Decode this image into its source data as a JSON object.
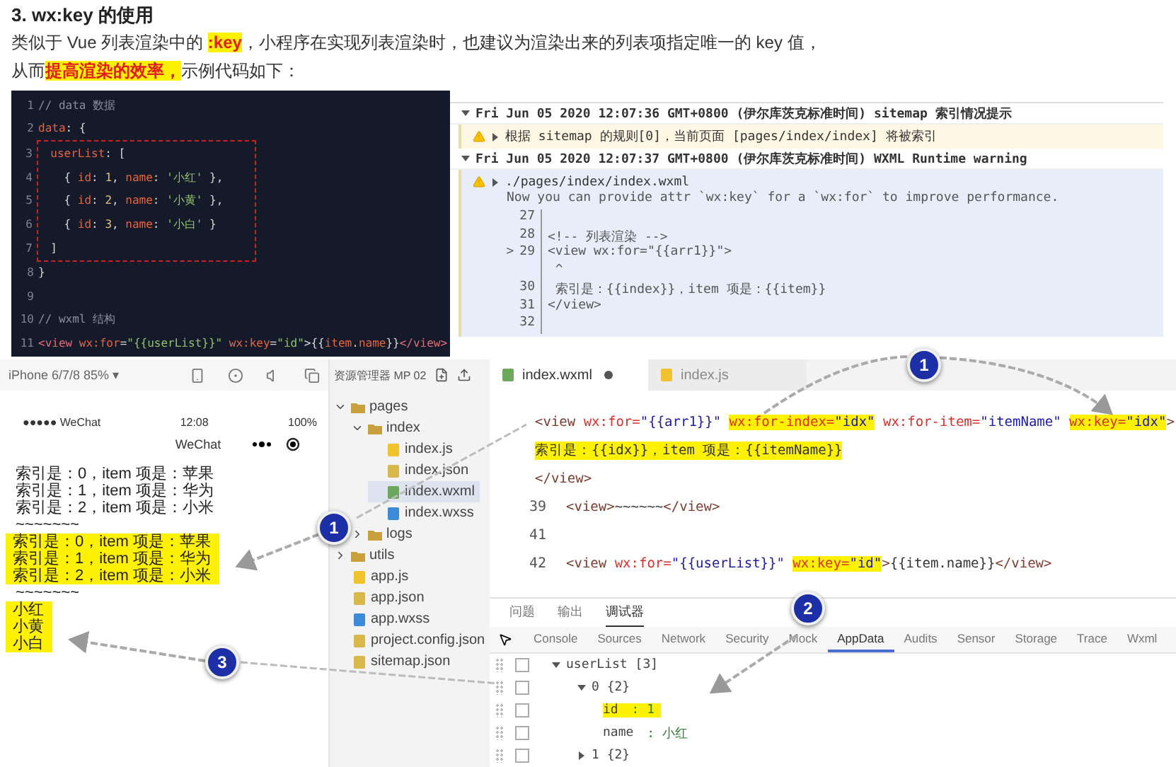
{
  "article": {
    "heading": "3. wx:key 的使用",
    "paragraph": [
      {
        "text": "类似于 Vue 列表渲染中的 ",
        "highlight": false
      },
      {
        "text": ":key",
        "highlight": true
      },
      {
        "text": "，小程序在实现列表渲染时，也建议为渲染出来的列表项指定唯一的 key 值，",
        "highlight": false
      }
    ],
    "paragraph2": [
      {
        "text": "从而",
        "highlight": false
      },
      {
        "text": "提高渲染的效率，",
        "highlight": true
      },
      {
        "text": "示例代码如下：",
        "highlight": false
      }
    ]
  },
  "code_sample": {
    "lines": [
      {
        "number": "1",
        "boxed": false,
        "tokens": [
          {
            "kind": "comment",
            "text": "// data 数据"
          }
        ]
      },
      {
        "number": "2",
        "boxed": false,
        "tokens": [
          {
            "kind": "key",
            "text": "data"
          },
          {
            "kind": "punct",
            "text": ": {"
          }
        ]
      },
      {
        "number": "3",
        "boxed": true,
        "tokens": [
          {
            "kind": "key",
            "text": "  userList"
          },
          {
            "kind": "punct",
            "text": ": ["
          }
        ]
      },
      {
        "number": "4",
        "boxed": true,
        "tokens": [
          {
            "kind": "punct",
            "text": "    { "
          },
          {
            "kind": "key",
            "text": "id"
          },
          {
            "kind": "punct",
            "text": ": "
          },
          {
            "kind": "number",
            "text": "1"
          },
          {
            "kind": "punct",
            "text": ", "
          },
          {
            "kind": "key",
            "text": "name"
          },
          {
            "kind": "punct",
            "text": ": "
          },
          {
            "kind": "string",
            "text": "'小红'"
          },
          {
            "kind": "punct",
            "text": " },"
          }
        ]
      },
      {
        "number": "5",
        "boxed": true,
        "tokens": [
          {
            "kind": "punct",
            "text": "    { "
          },
          {
            "kind": "key",
            "text": "id"
          },
          {
            "kind": "punct",
            "text": ": "
          },
          {
            "kind": "number",
            "text": "2"
          },
          {
            "kind": "punct",
            "text": ", "
          },
          {
            "kind": "key",
            "text": "name"
          },
          {
            "kind": "punct",
            "text": ": "
          },
          {
            "kind": "string",
            "text": "'小黄'"
          },
          {
            "kind": "punct",
            "text": " },"
          }
        ]
      },
      {
        "number": "6",
        "boxed": true,
        "tokens": [
          {
            "kind": "punct",
            "text": "    { "
          },
          {
            "kind": "key",
            "text": "id"
          },
          {
            "kind": "punct",
            "text": ": "
          },
          {
            "kind": "number",
            "text": "3"
          },
          {
            "kind": "punct",
            "text": ", "
          },
          {
            "kind": "key",
            "text": "name"
          },
          {
            "kind": "punct",
            "text": ": "
          },
          {
            "kind": "string",
            "text": "'小白'"
          },
          {
            "kind": "punct",
            "text": " }"
          }
        ]
      },
      {
        "number": "7",
        "boxed": true,
        "tokens": [
          {
            "kind": "punct",
            "text": "  ]"
          }
        ]
      },
      {
        "number": "8",
        "boxed": false,
        "tokens": [
          {
            "kind": "punct",
            "text": "}"
          }
        ]
      },
      {
        "number": "9",
        "boxed": false
      },
      {
        "number": "10",
        "boxed": false,
        "tokens": [
          {
            "kind": "comment",
            "text": "// wxml 结构"
          }
        ]
      },
      {
        "number": "11",
        "boxed": false,
        "tokens": [
          {
            "kind": "tag",
            "text": "<view"
          },
          {
            "kind": "key",
            "text": " wx:for"
          },
          {
            "kind": "punct",
            "text": "="
          },
          {
            "kind": "string",
            "text": "\"{{userList}}\""
          },
          {
            "kind": "key",
            "text": " wx:key"
          },
          {
            "kind": "punct",
            "text": "="
          },
          {
            "kind": "string",
            "text": "\"id\""
          },
          {
            "kind": "punct",
            "text": ">{{"
          },
          {
            "kind": "key",
            "text": "item"
          },
          {
            "kind": "punct",
            "text": "."
          },
          {
            "kind": "key",
            "text": "name"
          },
          {
            "kind": "punct",
            "text": "}}"
          },
          {
            "kind": "tag",
            "text": "</view>"
          }
        ]
      }
    ]
  },
  "console": {
    "groups": [
      {
        "header": "Fri Jun 05 2020 12:07:36 GMT+0800 (伊尔库茨克标准时间) sitemap 索引情况提示",
        "expanded": true,
        "kind": "warning",
        "message": "根据 sitemap 的规则[0]，当前页面 [pages/index/index] 将被索引"
      },
      {
        "header": "Fri Jun 05 2020 12:07:37 GMT+0800 (伊尔库茨克标准时间) WXML Runtime warning",
        "expanded": true,
        "kind": "runtime",
        "message": "./pages/index/index.wxml",
        "detail": "Now you can provide attr `wx:key` for a `wx:for` to improve performance.",
        "frame": [
          {
            "number": "27"
          },
          {
            "number": "28",
            "code": "<!-- 列表渲染 -->"
          },
          {
            "marker": ">",
            "number": "29",
            "code": "<view wx:for=\"{{arr1}}\">"
          },
          {
            "code": " ^"
          },
          {
            "number": "30",
            "code": " 索引是：{{index}}，item 项是：{{item}}"
          },
          {
            "number": "31",
            "code": "</view>"
          },
          {
            "number": "32"
          }
        ]
      }
    ]
  },
  "simulator": {
    "device": "iPhone 6/7/8 85% ▾",
    "carrier": "●●●●● WeChat",
    "time": "12:08",
    "battery": "100%",
    "nav_title": "WeChat",
    "lines": [
      {
        "text": "索引是：0，item 项是：苹果",
        "highlight": false
      },
      {
        "text": "索引是：1，item 项是：华为",
        "highlight": false
      },
      {
        "text": "索引是：2，item 项是：小米",
        "highlight": false
      },
      {
        "text": "~~~~~~~",
        "highlight": false
      },
      {
        "text": "索引是：0，item 项是：苹果",
        "highlight": true
      },
      {
        "text": "索引是：1，item 项是：华为",
        "highlight": true
      },
      {
        "text": "索引是：2，item 项是：小米",
        "highlight": true
      },
      {
        "text": "~~~~~~~",
        "highlight": false
      },
      {
        "text": "小红",
        "highlight": true
      },
      {
        "text": "小黄",
        "highlight": true
      },
      {
        "text": "小白",
        "highlight": true
      }
    ]
  },
  "explorer": {
    "title": "资源管理器 MP 02",
    "items": [
      {
        "label": "pages",
        "kind": "folder",
        "expanded": true,
        "selected": false,
        "children": [
          {
            "label": "index",
            "kind": "folder",
            "expanded": true,
            "selected": false,
            "children": [
              {
                "label": "index.js",
                "kind": "js",
                "selected": false
              },
              {
                "label": "index.json",
                "kind": "json",
                "selected": false
              },
              {
                "label": "index.wxml",
                "kind": "wxml",
                "selected": true
              },
              {
                "label": "index.wxss",
                "kind": "wxss",
                "selected": false
              }
            ]
          },
          {
            "label": "logs",
            "kind": "folder",
            "expanded": false,
            "selected": false
          }
        ]
      },
      {
        "label": "utils",
        "kind": "folder",
        "expanded": false,
        "selected": false
      },
      {
        "label": "app.js",
        "kind": "js",
        "selected": false
      },
      {
        "label": "app.json",
        "kind": "json",
        "selected": false
      },
      {
        "label": "app.wxss",
        "kind": "wxss",
        "selected": false
      },
      {
        "label": "project.config.json",
        "kind": "json",
        "selected": false
      },
      {
        "label": "sitemap.json",
        "kind": "json",
        "selected": false
      }
    ]
  },
  "editor": {
    "tabs": [
      {
        "label": "index.wxml",
        "kind": "wxml",
        "selected": true,
        "modified": true
      },
      {
        "label": "index.js",
        "kind": "js",
        "selected": false,
        "modified": false
      }
    ],
    "lines": [
      {
        "tokens": [
          {
            "kind": "tag",
            "text": "<view",
            "highlight": false
          },
          {
            "kind": "attr",
            "text": " wx:for=",
            "highlight": false
          },
          {
            "kind": "string",
            "text": "\"{{arr1}}\" ",
            "highlight": false
          },
          {
            "kind": "attr",
            "text": "wx:for-index=",
            "highlight": true
          },
          {
            "kind": "string",
            "text": "\"idx\"",
            "highlight": true
          },
          {
            "kind": "attr",
            "text": " wx:for-item=",
            "highlight": false
          },
          {
            "kind": "string",
            "text": "\"itemName\" ",
            "highlight": false
          },
          {
            "kind": "attr",
            "text": "wx:key=",
            "highlight": true
          },
          {
            "kind": "string",
            "text": "\"idx\"",
            "highlight": true
          },
          {
            "kind": "tag",
            "text": ">",
            "highlight": false
          }
        ]
      },
      {
        "tokens": [
          {
            "kind": "text",
            "text": "索引是：{{idx}}，item 项是：{{itemName}}",
            "highlight": true
          }
        ]
      },
      {
        "tokens": [
          {
            "kind": "tag",
            "text": "</view>",
            "highlight": false
          }
        ]
      },
      {
        "number": "39",
        "tokens": [
          {
            "kind": "tag",
            "text": "<view>",
            "highlight": false
          },
          {
            "kind": "text",
            "text": "~~~~~~",
            "highlight": false
          },
          {
            "kind": "tag",
            "text": "</view>",
            "highlight": false
          }
        ]
      },
      {
        "number": "41"
      },
      {
        "number": "42",
        "tokens": [
          {
            "kind": "tag",
            "text": "<view",
            "highlight": false
          },
          {
            "kind": "attr",
            "text": " wx:for=",
            "highlight": false
          },
          {
            "kind": "string",
            "text": "\"{{userList}}\" ",
            "highlight": false
          },
          {
            "kind": "attr",
            "text": "wx:key=",
            "highlight": true
          },
          {
            "kind": "string",
            "text": "\"id\"",
            "highlight": true
          },
          {
            "kind": "tag",
            "text": ">",
            "highlight": false
          },
          {
            "kind": "text",
            "text": "{{item.name}}",
            "highlight": false
          },
          {
            "kind": "tag",
            "text": "</view>",
            "highlight": false
          }
        ]
      }
    ]
  },
  "devtools": {
    "panels": [
      {
        "label": "问题",
        "selected": false
      },
      {
        "label": "输出",
        "selected": false
      },
      {
        "label": "调试器",
        "selected": true
      }
    ],
    "tools": [
      {
        "label": "Console",
        "selected": false
      },
      {
        "label": "Sources",
        "selected": false
      },
      {
        "label": "Network",
        "selected": false
      },
      {
        "label": "Security",
        "selected": false
      },
      {
        "label": "Mock",
        "selected": false
      },
      {
        "label": "AppData",
        "selected": true
      },
      {
        "label": "Audits",
        "selected": false
      },
      {
        "label": "Sensor",
        "selected": false
      },
      {
        "label": "Storage",
        "selected": false
      },
      {
        "label": "Trace",
        "selected": false
      },
      {
        "label": "Wxml",
        "selected": false
      }
    ],
    "tree": [
      {
        "label": "userList",
        "info": "[3]",
        "checked": false,
        "expanded": true,
        "children": [
          {
            "label": "0",
            "info": "{2}",
            "checked": false,
            "expanded": true,
            "children": [
              {
                "label": "id",
                "value": ": 1",
                "checked": false,
                "highlight": true
              },
              {
                "label": "name",
                "value": ": 小红",
                "checked": false,
                "highlight": false
              }
            ]
          },
          {
            "label": "1",
            "info": "{2}",
            "checked": false,
            "expanded": false
          }
        ]
      }
    ]
  },
  "annotations": [
    {
      "label": "1"
    },
    {
      "label": "1"
    },
    {
      "label": "2"
    },
    {
      "label": "3"
    }
  ]
}
